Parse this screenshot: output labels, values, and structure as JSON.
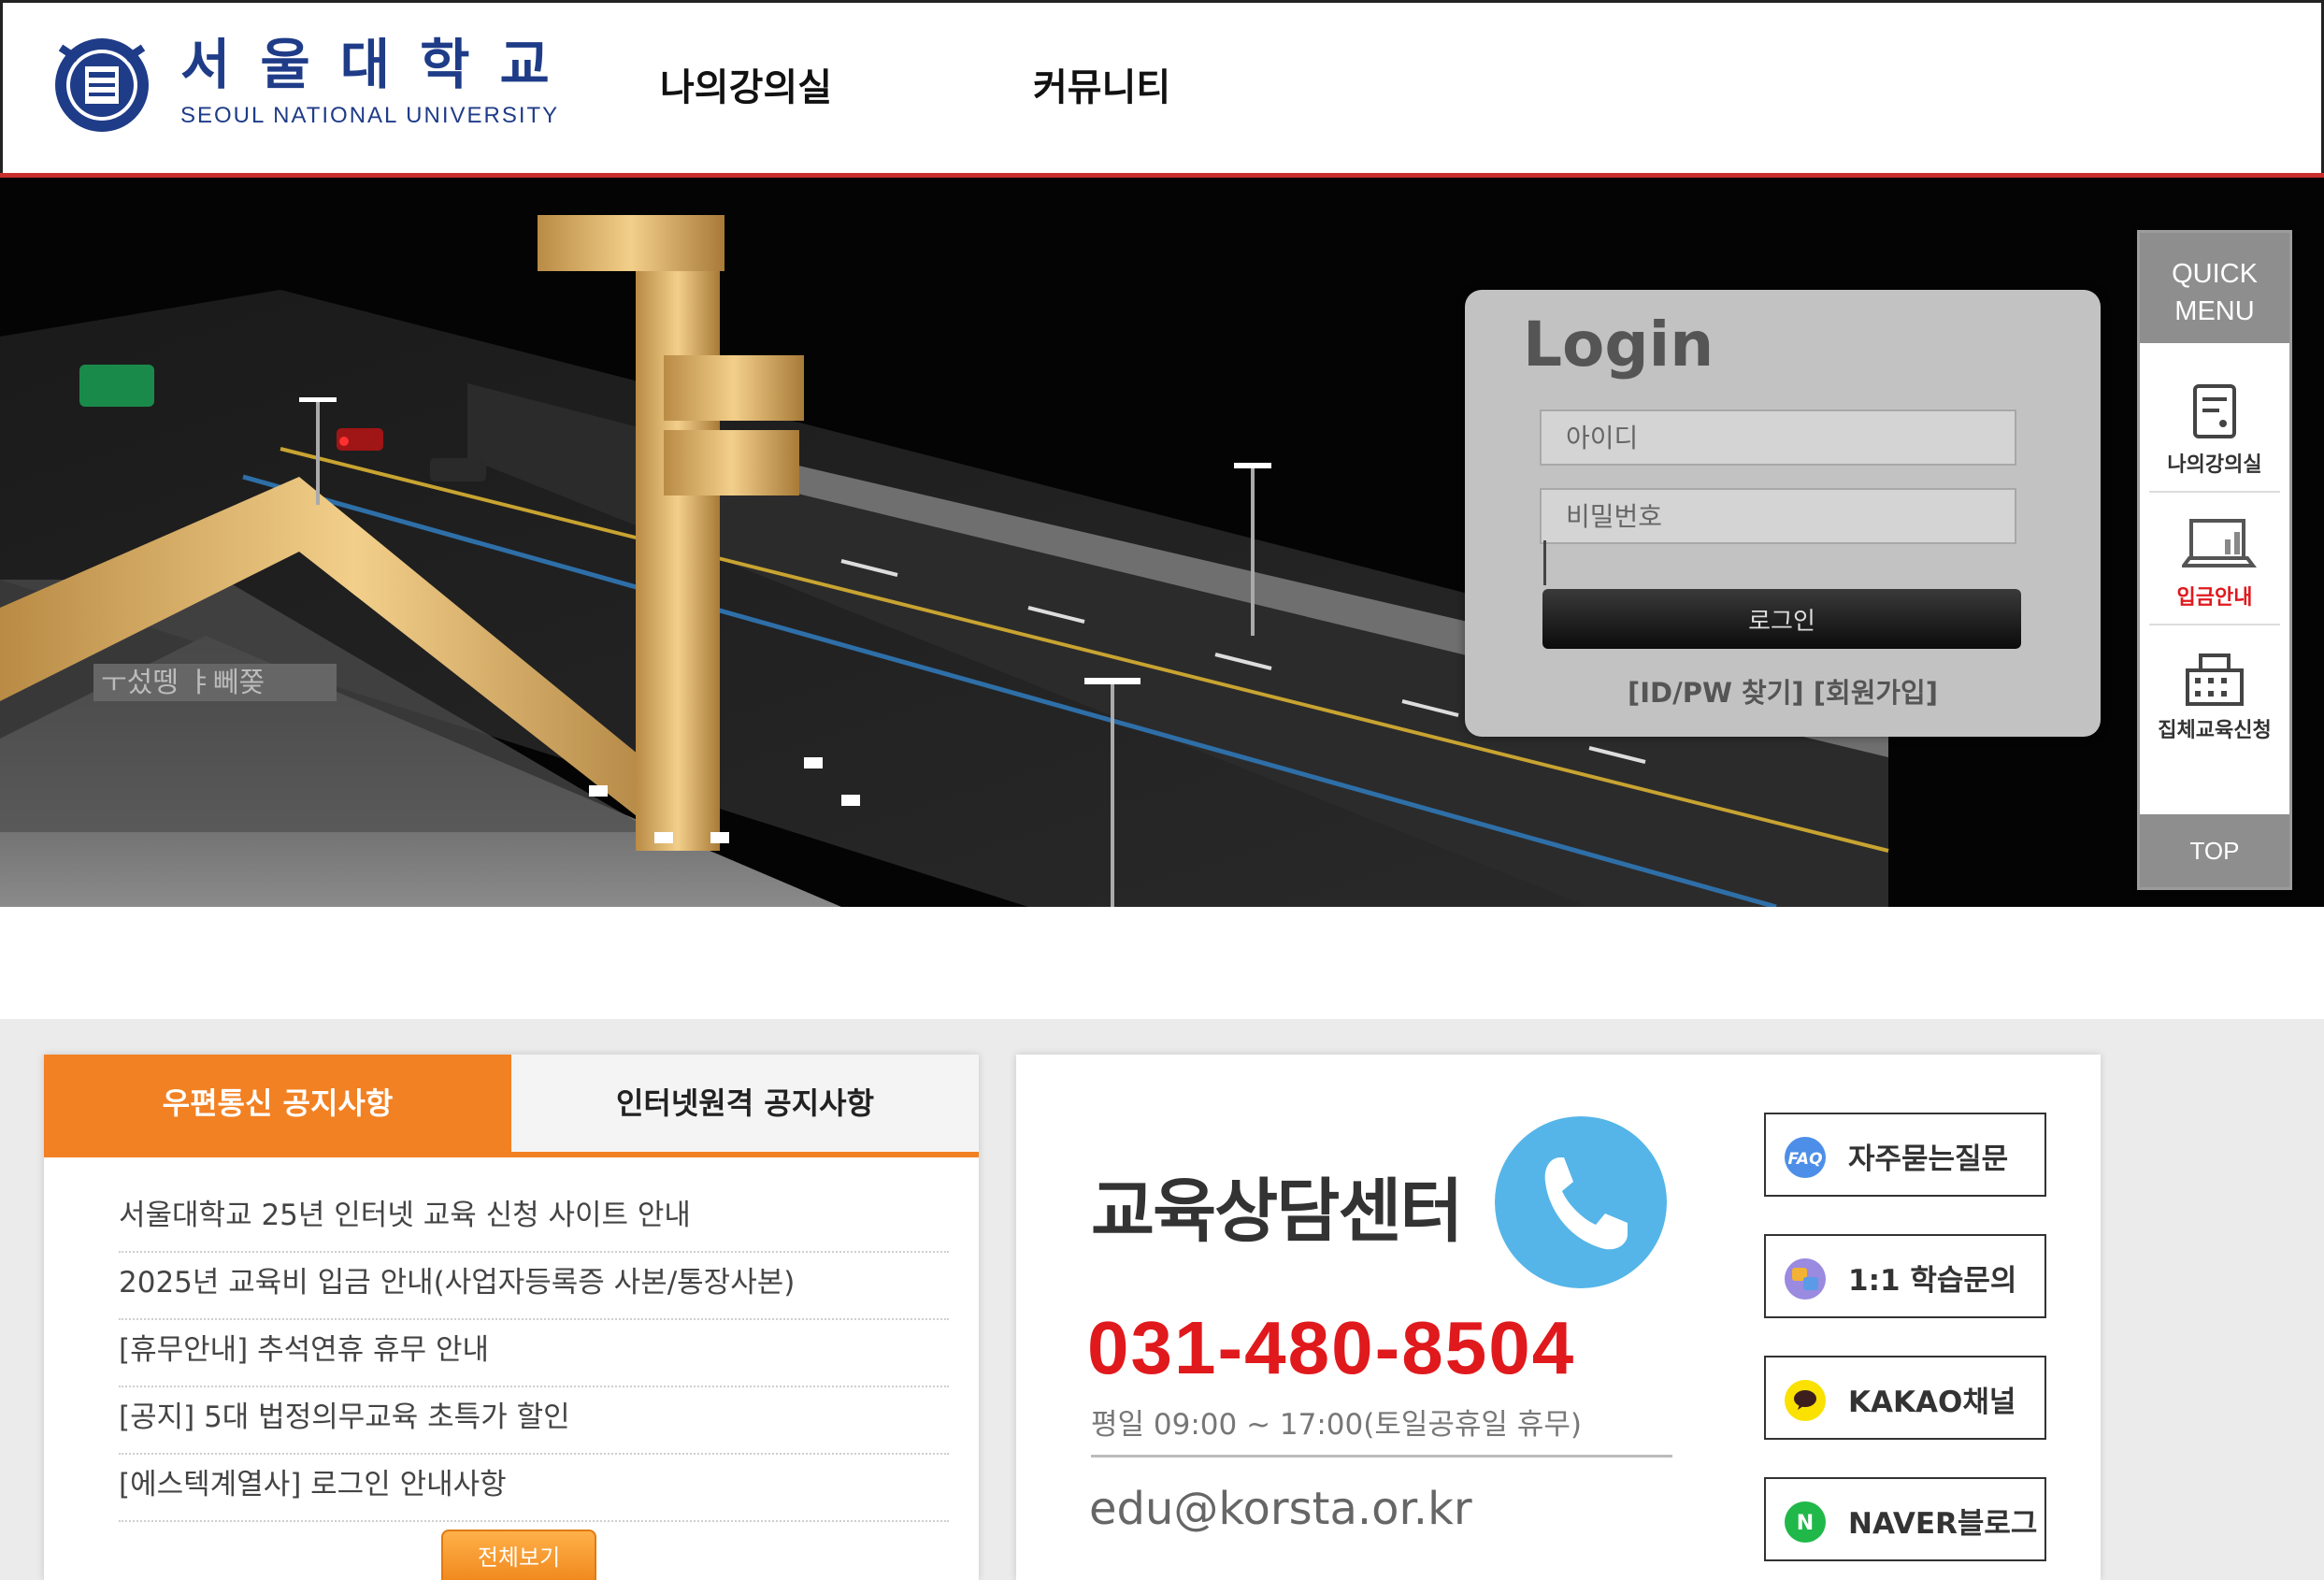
{
  "header": {
    "logo_kr": "서울대학교",
    "logo_en": "SEOUL NATIONAL UNIVERSITY",
    "nav": [
      {
        "label": "나의강의실"
      },
      {
        "label": "커뮤니티"
      }
    ]
  },
  "login": {
    "title": "Login",
    "id_placeholder": "아이디",
    "pw_placeholder": "비밀번호",
    "submit_label": "로그인",
    "links": "[ID/PW 찾기] [회원가입]"
  },
  "quick_menu": {
    "title_line1": "QUICK",
    "title_line2": "MENU",
    "items": [
      {
        "label": "나의강의실",
        "icon": "notebook-icon"
      },
      {
        "label": "입금안내",
        "icon": "laptop-chart-icon",
        "color": "#e0191d"
      },
      {
        "label": "집체교육신청",
        "icon": "building-icon"
      }
    ],
    "top_label": "TOP"
  },
  "notice": {
    "tabs": [
      {
        "label": "우편통신 공지사항",
        "active": true
      },
      {
        "label": "인터넷원격 공지사항",
        "active": false
      }
    ],
    "items": [
      "서울대학교 25년 인터넷 교육 신청 사이트 안내",
      "2025년 교육비 입금 안내(사업자등록증 사본/통장사본)",
      "[휴무안내] 추석연휴 휴무 안내",
      "[공지] 5대 법정의무교육 초특가 할인",
      "[에스텍계열사] 로그인 안내사항"
    ],
    "view_all": "전체보기"
  },
  "center": {
    "title": "교육상담센터",
    "phone": "031-480-8504",
    "hours": "평일 09:00 ~ 17:00(토일공휴일 휴무)",
    "email": "edu@korsta.or.kr",
    "buttons": [
      {
        "label": "자주묻는질문",
        "icon": "faq-icon"
      },
      {
        "label": "1:1 학습문의",
        "icon": "qa-icon"
      },
      {
        "label": "KAKAO채널",
        "icon": "kakao-icon"
      },
      {
        "label": "NAVER블로그",
        "icon": "naver-icon"
      }
    ]
  },
  "colors": {
    "accent_orange": "#f28123",
    "brand_blue": "#1f3c88",
    "phone_red": "#e0191d",
    "header_line": "#c8302f"
  }
}
